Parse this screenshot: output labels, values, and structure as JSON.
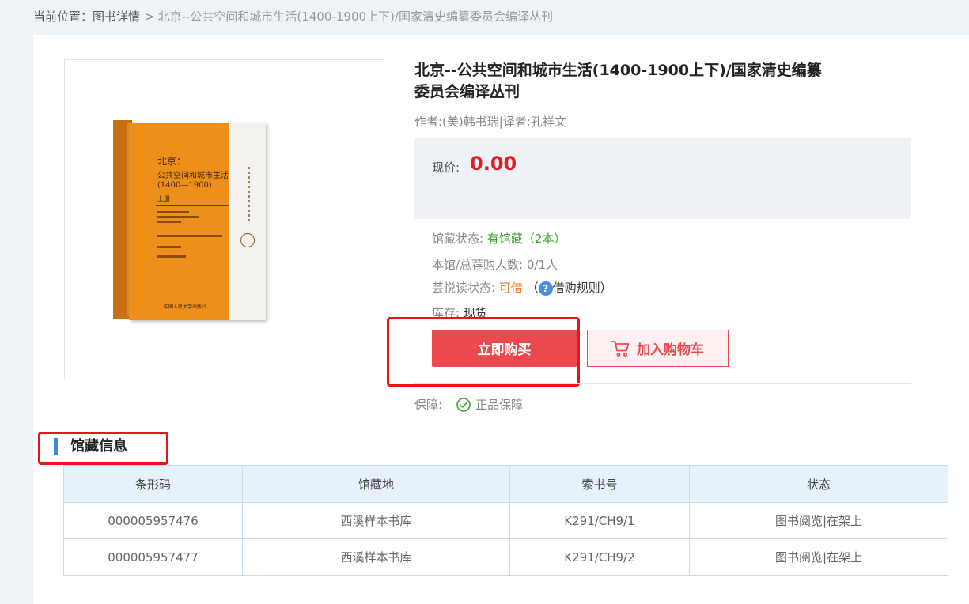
{
  "breadcrumb": {
    "prefix": "当前位置：",
    "link": "图书详情",
    "separator": ">",
    "current": "北京--公共空间和城市生活(1400-1900上下)/国家清史编纂委员会编译丛刊"
  },
  "cover": {
    "line1": "北京：",
    "line2": "公共空间和城市生活",
    "line3": "(1400—1900)",
    "line4": "上册",
    "publisher": "中国人民大学出版社"
  },
  "book": {
    "title": "北京--公共空间和城市生活(1400-1900上下)/国家清史编纂委员会编译丛刊",
    "author": "作者:(美)韩书瑞|译者:孔祥文"
  },
  "price": {
    "label": "现价:",
    "value": "0.00"
  },
  "meta": {
    "holding_label": "馆藏状态:",
    "holding_value": "有馆藏（2本）",
    "recommend_label": "本馆/总荐购人数:",
    "recommend_value": "0/1人",
    "yunyue_label": "芸悦读状态:",
    "yunyue_value": "可借",
    "paren_open": "（",
    "rule_text": "借购规则",
    "paren_close": "）",
    "stock_label": "库存:",
    "stock_value": "现货"
  },
  "buttons": {
    "buy": "立即购买",
    "cart": "加入购物车"
  },
  "guarantee": {
    "label": "保障:",
    "value": "正品保障"
  },
  "holdings": {
    "title": "馆藏信息",
    "headers": [
      "条形码",
      "馆藏地",
      "索书号",
      "状态"
    ],
    "rows": [
      [
        "000005957476",
        "西溪样本书库",
        "K291/CH9/1",
        "图书阅览|在架上"
      ],
      [
        "000005957477",
        "西溪样本书库",
        "K291/CH9/2",
        "图书阅览|在架上"
      ]
    ]
  },
  "colors": {
    "accent_red": "#ea4a4f",
    "price_red": "#e02020",
    "green": "#3fa12f",
    "orange": "#f07b2e",
    "blue": "#3f8bd9"
  },
  "icons": {
    "cart": "cart-icon",
    "check": "check-circle-icon",
    "help": "question-icon"
  }
}
